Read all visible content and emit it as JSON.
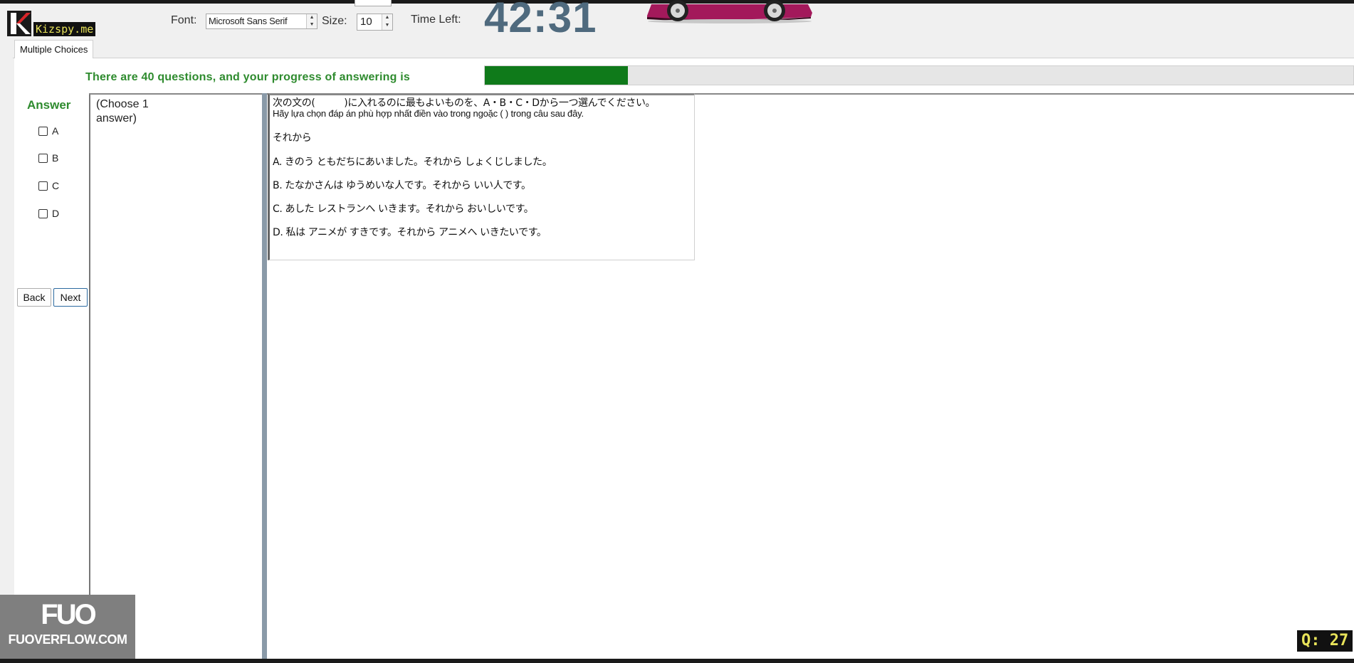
{
  "app": {
    "logo_text": "Kizspy.me",
    "tab_label": "Multiple Choices"
  },
  "toolbar": {
    "font_label": "Font:",
    "font_value": "Microsoft Sans Serif",
    "size_label": "Size:",
    "size_value": "10",
    "time_left_label": "Time Left:",
    "time_left_value": "42:31"
  },
  "progress": {
    "text": "There are 40 questions, and your progress of answering is",
    "answered_fraction": 0.165,
    "color": "#0f7a1a"
  },
  "answer": {
    "title": "Answer",
    "options": [
      "A",
      "B",
      "C",
      "D"
    ],
    "back_label": "Back",
    "next_label": "Next"
  },
  "instruction": "(Choose 1 answer)",
  "question": {
    "prompt_jp": "次の文の(　　　)に入れるのに最もよいものを、A・B・C・Dから一つ選んでください。",
    "prompt_vn": "Hãy lựa chọn đáp án phù hợp nhất điền vào trong ngoặc (            ) trong câu sau đây.",
    "keyword": "それから",
    "choices": [
      "A.  きのう  ともだちにあいました。それから  しょくじしました。",
      "B.  たなかさんは  ゆうめいな人です。それから  いい人です。",
      "C.  あした  レストランへ いきます。それから  おいしいです。",
      "D.  私は  アニメが  すきです。それから  アニメへ  いきたいです。"
    ]
  },
  "watermark": {
    "logo": "FUO",
    "text": "FUOVERFLOW.COM"
  },
  "question_counter": "Q: 27"
}
